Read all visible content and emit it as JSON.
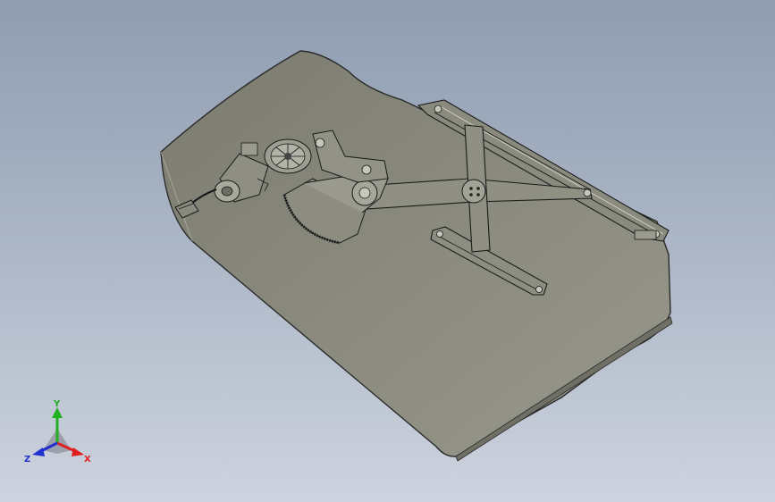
{
  "viewport": {
    "background_top": "#8f9db1",
    "background_bottom": "#cdd3de",
    "part_color": "#8e8e82",
    "edge_color": "#1f1f1f"
  },
  "model": {
    "components": [
      "glass-panel-icon",
      "motor-icon",
      "connector-icon",
      "gear-wheel-icon",
      "sector-gear-icon",
      "scissor-arm-icon",
      "guide-rail-icon",
      "lower-rail-icon"
    ]
  },
  "triad": {
    "x_label": "X",
    "y_label": "Y",
    "z_label": "Z",
    "x_color": "#e02020",
    "y_color": "#20b020",
    "z_color": "#2030d0"
  }
}
